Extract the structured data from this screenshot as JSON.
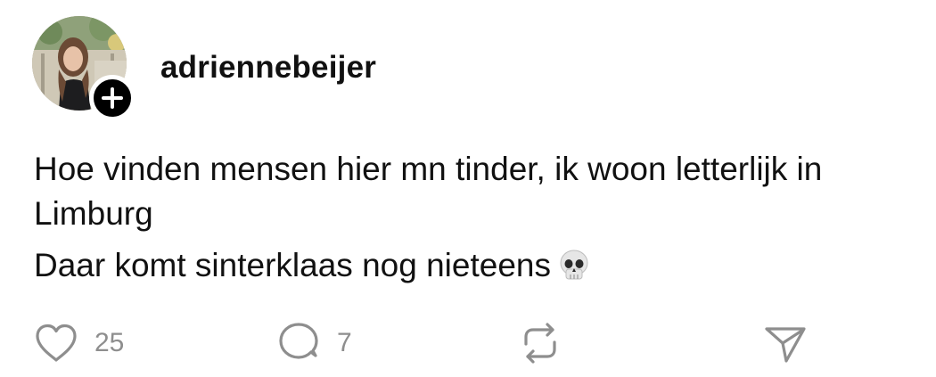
{
  "post": {
    "username": "adriennebeijer",
    "text_line_1": "Hoe vinden mensen hier mn tinder, ik woon letterlijk in Limburg",
    "text_line_2": "Daar komt sinterklaas nog nieteens",
    "emoji": "skull-emoji"
  },
  "actions": {
    "like_count": "25",
    "reply_count": "7"
  },
  "icons": {
    "like": "heart-icon",
    "reply": "comment-bubble-icon",
    "repost": "repost-icon",
    "share": "send-icon",
    "follow": "plus-icon"
  },
  "colors": {
    "text": "#111111",
    "muted": "#8e8e8e",
    "badge": "#000000"
  }
}
